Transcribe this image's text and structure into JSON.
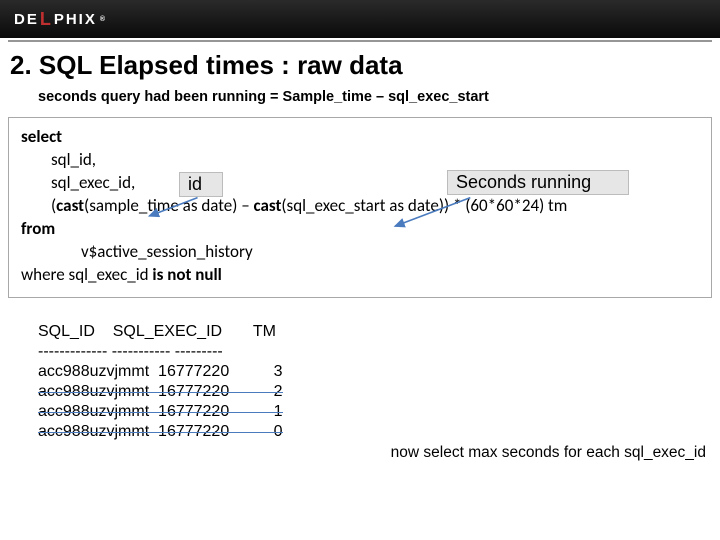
{
  "header": {
    "brand_pre": "DE",
    "brand_accent": "L",
    "brand_post": "PHIX",
    "brand_tm": "®"
  },
  "slide": {
    "title": "2. SQL Elapsed times : raw data",
    "subtitle": "seconds query had been running = Sample_time – sql_exec_start",
    "callout_id": "id",
    "callout_seconds": "Seconds running",
    "footnote": "now select max seconds for each sql_exec_id"
  },
  "code": {
    "l1": "select",
    "l2": "sql_id,",
    "l3": "sql_exec_id,",
    "l4a": "(",
    "l4b": "cast",
    "l4c": "(sample_time  as date) –  ",
    "l4d": "cast",
    "l4e": "(sql_exec_start as date)) * (60*60*24) tm",
    "l5": "from",
    "l6": "v$active_session_history",
    "l7a": "where sql_exec_id ",
    "l7b": "is not null"
  },
  "results": {
    "header": "SQL_ID    SQL_EXEC_ID       TM",
    "sep": "------------- ----------- ---------",
    "r1": "acc988uzvjmmt  16777220          3",
    "r2": "acc988uzvjmmt  16777220          2",
    "r3": "acc988uzvjmmt  16777220          1",
    "r4": "acc988uzvjmmt  16777220          0"
  },
  "chart_data": {
    "type": "table",
    "title": "SQL Elapsed times : raw data",
    "columns": [
      "SQL_ID",
      "SQL_EXEC_ID",
      "TM"
    ],
    "rows": [
      [
        "acc988uzvjmmt",
        16777220,
        3
      ],
      [
        "acc988uzvjmmt",
        16777220,
        2
      ],
      [
        "acc988uzvjmmt",
        16777220,
        1
      ],
      [
        "acc988uzvjmmt",
        16777220,
        0
      ]
    ],
    "formula": "TM = (cast(sample_time as date) - cast(sql_exec_start as date)) * (60*60*24)"
  }
}
